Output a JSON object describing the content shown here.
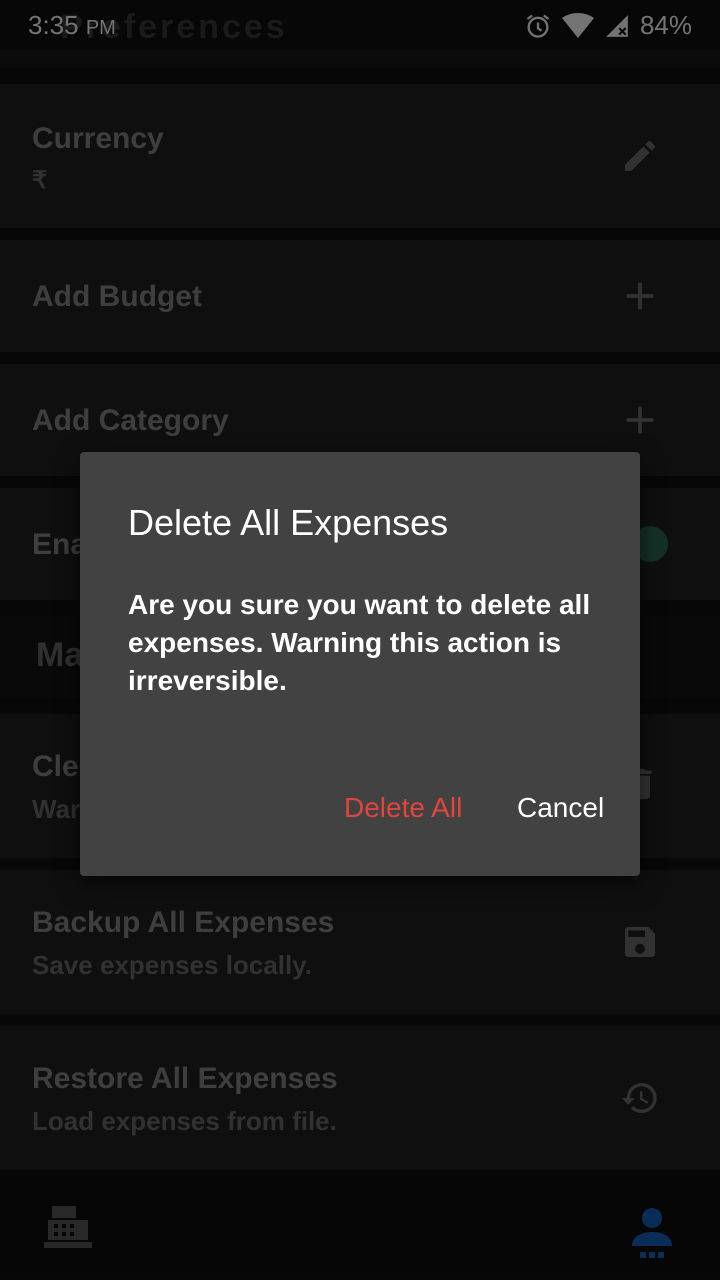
{
  "status_bar": {
    "time": "3:35",
    "ampm": "PM",
    "battery": "84%"
  },
  "section_preferences": {
    "title": "Preferences"
  },
  "section_manage": {
    "title": "Ma"
  },
  "cards": {
    "currency": {
      "title": "Currency",
      "value": "₹"
    },
    "add_budget": {
      "title": "Add Budget"
    },
    "add_category": {
      "title": "Add Category"
    },
    "enable": {
      "title": "Ena"
    },
    "clear": {
      "title": "Cle",
      "subtitle": "War"
    },
    "backup": {
      "title": "Backup All Expenses",
      "subtitle": "Save expenses locally."
    },
    "restore": {
      "title": "Restore All Expenses",
      "subtitle": "Load expenses from file."
    }
  },
  "dialog": {
    "title": "Delete All Expenses",
    "message": "Are you sure you want to delete all expenses. Warning this action is irreversible.",
    "confirm_label": "Delete All",
    "cancel_label": "Cancel",
    "confirm_color": "#e0453e"
  },
  "icons": {
    "alarm": "alarm-icon",
    "wifi": "wifi-icon",
    "signal": "signal-icon",
    "edit": "pencil-icon",
    "add": "plus-icon",
    "delete": "trash-icon",
    "save": "floppy-icon",
    "restore": "history-icon",
    "nav_expenses": "cash-register-icon",
    "nav_profile": "person-icon"
  },
  "colors": {
    "accent_profile": "#1565c0",
    "toggle_on": "#2e6e57"
  }
}
